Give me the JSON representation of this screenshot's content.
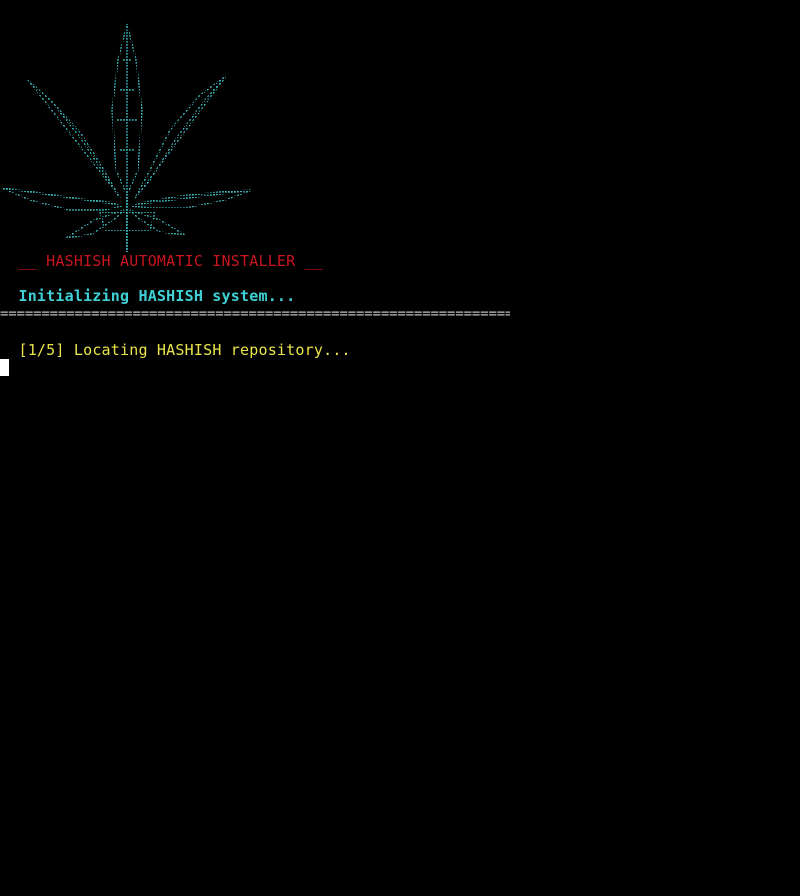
{
  "colors": {
    "background": "#000000",
    "art": "#3fbfc4",
    "banner": "#c8161d",
    "status": "#3fd1d6",
    "separator": "#bfbfbf",
    "step": "#e9e44a",
    "cursor": "#ffffff"
  },
  "art": {
    "icon": "cannabis-leaf-ascii-art"
  },
  "terminal": {
    "banner": "  __ HASHISH AUTOMATIC INSTALLER __",
    "status": "  Initializing HASHISH system...",
    "separator": "========================================================================",
    "step_prefix": "  [1/5] ",
    "step_text": "Locating HASHISH repository..."
  }
}
